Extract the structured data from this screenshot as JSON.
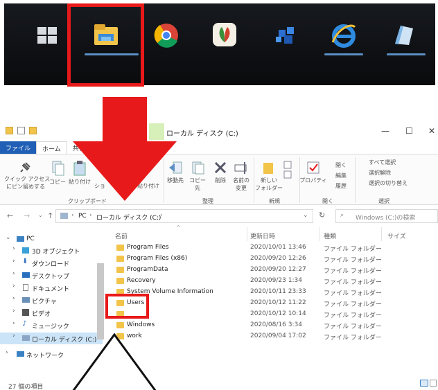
{
  "taskbar": {
    "icons": [
      "windows-start-icon",
      "file-explorer-icon",
      "chrome-icon",
      "app-icon",
      "app-icon",
      "internet-explorer-icon",
      "app-icon"
    ]
  },
  "window": {
    "title": "ローカル ディスク (C:)",
    "controls": {
      "minimize": "—",
      "maximize": "☐",
      "close": "✕"
    }
  },
  "tabs": [
    "ファイル",
    "ホーム",
    "共有"
  ],
  "ribbon": {
    "clipboard": {
      "pin": "クイック アクセス\nにピン留めする",
      "copy": "コピー",
      "paste": "貼り付け",
      "shortcut": "ショ",
      "paste_shortcut": "貼り付け",
      "group": "クリップボード"
    },
    "organize": {
      "move_to": "移動先",
      "copy_to": "コピー先",
      "delete": "削除",
      "rename": "名前の\n変更",
      "group": "整理"
    },
    "new": {
      "new_folder": "新しい\nフォルダー",
      "group": "新規"
    },
    "open": {
      "properties": "プロパティ",
      "open": "開く",
      "edit": "編集",
      "history": "履歴",
      "group": "開く"
    },
    "select": {
      "select_all": "すべて選択",
      "select_none": "選択解除",
      "invert": "選択の切り替え",
      "group": "選択"
    }
  },
  "address": {
    "path_root": "PC",
    "path_drive": "ローカル ディスク (C:)",
    "search_placeholder": "Windows (C:)の検索"
  },
  "nav": [
    {
      "label": "PC",
      "icon": "pc-icon"
    },
    {
      "label": "3D オブジェクト",
      "icon": "cube-icon"
    },
    {
      "label": "ダウンロード",
      "icon": "download-icon"
    },
    {
      "label": "デスクトップ",
      "icon": "desktop-icon"
    },
    {
      "label": "ドキュメント",
      "icon": "document-icon"
    },
    {
      "label": "ピクチャ",
      "icon": "picture-icon"
    },
    {
      "label": "ビデオ",
      "icon": "video-icon"
    },
    {
      "label": "ミュージック",
      "icon": "music-icon"
    },
    {
      "label": "ローカル ディスク (C:)",
      "icon": "drive-icon"
    },
    {
      "label": "ネットワーク",
      "icon": "network-icon"
    }
  ],
  "columns": {
    "name": "名前",
    "date": "更新日時",
    "type": "種類",
    "size": "サイズ"
  },
  "files": [
    {
      "name": "Program Files",
      "date": "2020/10/01 13:46",
      "type": "ファイル フォルダー"
    },
    {
      "name": "Program Files (x86)",
      "date": "2020/09/20 12:26",
      "type": "ファイル フォルダー"
    },
    {
      "name": "ProgramData",
      "date": "2020/09/20 12:27",
      "type": "ファイル フォルダー"
    },
    {
      "name": "Recovery",
      "date": "2020/09/23 1:34",
      "type": "ファイル フォルダー"
    },
    {
      "name": "System Volume Information",
      "date": "2020/10/11 23:33",
      "type": "ファイル フォルダー"
    },
    {
      "name": "Users",
      "date": "2020/10/12 11:22",
      "type": "ファイル フォルダー"
    },
    {
      "name": "",
      "date": "2020/10/12 10:14",
      "type": "ファイル フォルダー"
    },
    {
      "name": "Windows",
      "date": "2020/08/16 3:34",
      "type": "ファイル フォルダー"
    },
    {
      "name": "work",
      "date": "2020/09/04 17:02",
      "type": "ファイル フォルダー"
    }
  ],
  "status": "27 個の項目",
  "colors": {
    "highlight": "#e8191a",
    "accent": "#1f5fb5",
    "folder": "#f2c44a"
  }
}
